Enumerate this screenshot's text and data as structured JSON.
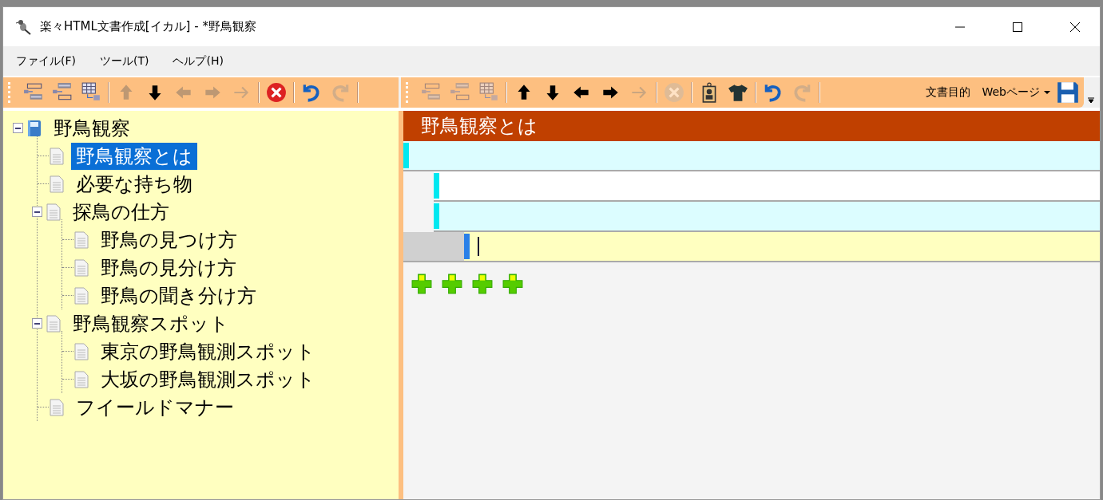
{
  "window": {
    "title": "楽々HTML文書作成[イカル] - *野鳥観察"
  },
  "menu": [
    "ファイル(F)",
    "ツール(T)",
    "ヘルプ(H)"
  ],
  "left_toolbar": [
    {
      "kind": "outline-add",
      "disabled": false
    },
    {
      "kind": "outline-child",
      "disabled": false
    },
    {
      "kind": "outline-table",
      "disabled": false
    },
    {
      "kind": "up",
      "disabled": true
    },
    {
      "kind": "down",
      "disabled": false
    },
    {
      "kind": "left",
      "disabled": true
    },
    {
      "kind": "right",
      "disabled": true
    },
    {
      "kind": "thin-arrow",
      "disabled": true
    },
    {
      "kind": "delete",
      "disabled": false
    },
    {
      "kind": "undo",
      "disabled": false
    },
    {
      "kind": "redo",
      "disabled": true
    }
  ],
  "right_toolbar": [
    {
      "kind": "outline-add",
      "disabled": true
    },
    {
      "kind": "outline-child",
      "disabled": true
    },
    {
      "kind": "outline-table",
      "disabled": true
    },
    {
      "kind": "up",
      "disabled": false
    },
    {
      "kind": "down",
      "disabled": false
    },
    {
      "kind": "left",
      "disabled": false
    },
    {
      "kind": "right",
      "disabled": false
    },
    {
      "kind": "thin-arrow",
      "disabled": true
    },
    {
      "kind": "delete",
      "disabled": true
    },
    {
      "kind": "tag",
      "disabled": false
    },
    {
      "kind": "shirt",
      "disabled": false
    },
    {
      "kind": "undo",
      "disabled": false
    },
    {
      "kind": "redo",
      "disabled": true
    }
  ],
  "purpose": {
    "label": "文書目的",
    "value": "Webページ"
  },
  "tree": [
    {
      "label": "野鳥観察",
      "kind": "book",
      "expanded": true,
      "selected": false,
      "children": [
        {
          "label": "野鳥観察とは",
          "kind": "page",
          "selected": true
        },
        {
          "label": "必要な持ち物",
          "kind": "page",
          "selected": false
        },
        {
          "label": "探鳥の仕方",
          "kind": "page",
          "expanded": true,
          "selected": false,
          "children": [
            {
              "label": "野鳥の見つけ方",
              "kind": "page",
              "selected": false
            },
            {
              "label": "野鳥の見分け方",
              "kind": "page",
              "selected": false
            },
            {
              "label": "野鳥の聞き分け方",
              "kind": "page",
              "selected": false
            }
          ]
        },
        {
          "label": "野鳥観察スポット",
          "kind": "page",
          "expanded": true,
          "selected": false,
          "children": [
            {
              "label": "東京の野鳥観測スポット",
              "kind": "page",
              "selected": false
            },
            {
              "label": "大坂の野鳥観測スポット",
              "kind": "page",
              "selected": false
            }
          ]
        },
        {
          "label": "フイールドマナー",
          "kind": "page",
          "selected": false
        }
      ]
    }
  ],
  "editor": {
    "heading": "野鳥観察とは",
    "blocks": [
      {
        "kind": "cyan",
        "children": [
          {
            "kind": "white"
          },
          {
            "kind": "cyan",
            "children": [
              {
                "kind": "input"
              }
            ]
          }
        ]
      }
    ]
  }
}
